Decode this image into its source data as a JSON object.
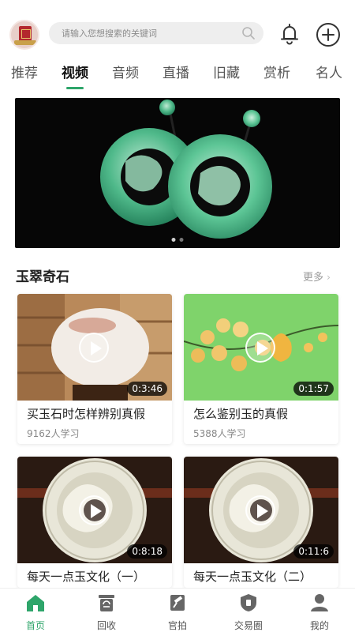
{
  "header": {
    "search_placeholder": "请输入您想搜索的关键词"
  },
  "tabs": [
    {
      "label": "推荐"
    },
    {
      "label": "视频",
      "active": true
    },
    {
      "label": "音频"
    },
    {
      "label": "直播"
    },
    {
      "label": "旧藏"
    },
    {
      "label": "赏析"
    },
    {
      "label": "名人"
    }
  ],
  "banner": {
    "page_count": 2,
    "current_page": 1
  },
  "section": {
    "title": "玉翠奇石",
    "more_label": "更多"
  },
  "cards": [
    {
      "title": "买玉石时怎样辨别真假",
      "learners": "9162人学习",
      "duration": "0:3:46"
    },
    {
      "title": "怎么鉴别玉的真假",
      "learners": "5388人学习",
      "duration": "0:1:57"
    },
    {
      "title": "每天一点玉文化（一）",
      "learners": "",
      "duration": "0:8:18"
    },
    {
      "title": "每天一点玉文化（二）",
      "learners": "",
      "duration": "0:11:6"
    }
  ],
  "bottom_nav": [
    {
      "label": "首页",
      "icon": "home-icon",
      "active": true
    },
    {
      "label": "回收",
      "icon": "recycle-icon"
    },
    {
      "label": "官拍",
      "icon": "auction-gavel-icon"
    },
    {
      "label": "交易圈",
      "icon": "trade-shield-icon"
    },
    {
      "label": "我的",
      "icon": "profile-icon"
    }
  ],
  "colors": {
    "accent": "#2ea56a",
    "text": "#222222",
    "muted": "#888888"
  }
}
